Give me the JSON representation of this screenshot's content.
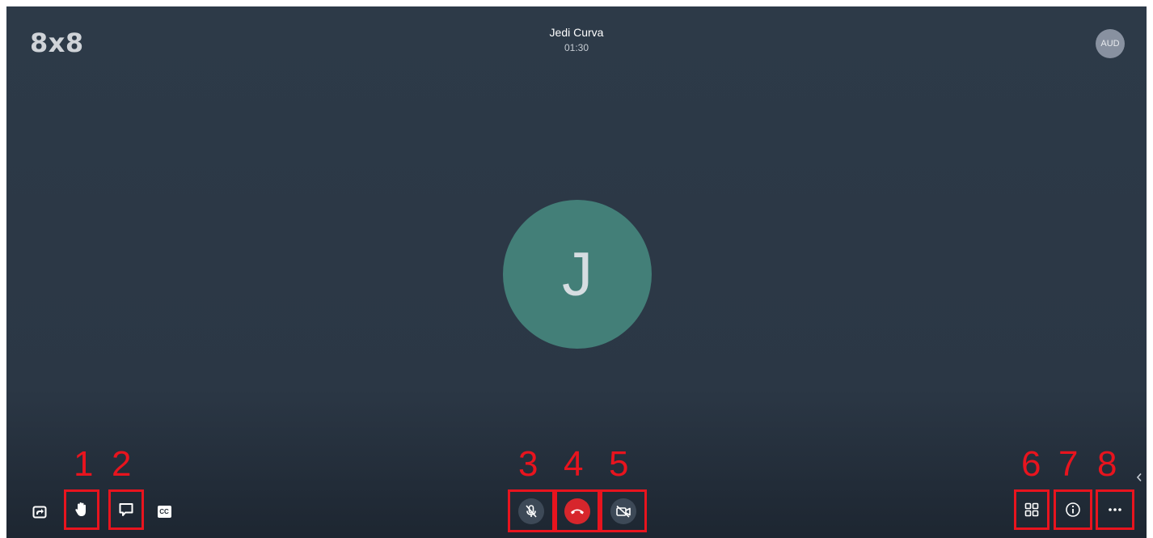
{
  "app": {
    "logo": "8x8"
  },
  "call": {
    "name": "Jedi Curva",
    "duration": "01:30"
  },
  "user_badge": "AUD",
  "participant": {
    "initial": "J"
  },
  "annotations": {
    "n1": "1",
    "n2": "2",
    "n3": "3",
    "n4": "4",
    "n5": "5",
    "n6": "6",
    "n7": "7",
    "n8": "8"
  },
  "toolbar": {
    "left": [
      "share-screen-icon",
      "raise-hand-icon",
      "chat-icon",
      "closed-captions-icon"
    ],
    "cc_label": "CC",
    "center": [
      "mic-muted-icon",
      "hangup-icon",
      "camera-off-icon"
    ],
    "right": [
      "tile-view-icon",
      "info-icon",
      "more-icon"
    ]
  },
  "colors": {
    "background": "#2b3745",
    "avatar": "#437f78",
    "hangup": "#d7262c",
    "annotation": "#e8141e"
  }
}
